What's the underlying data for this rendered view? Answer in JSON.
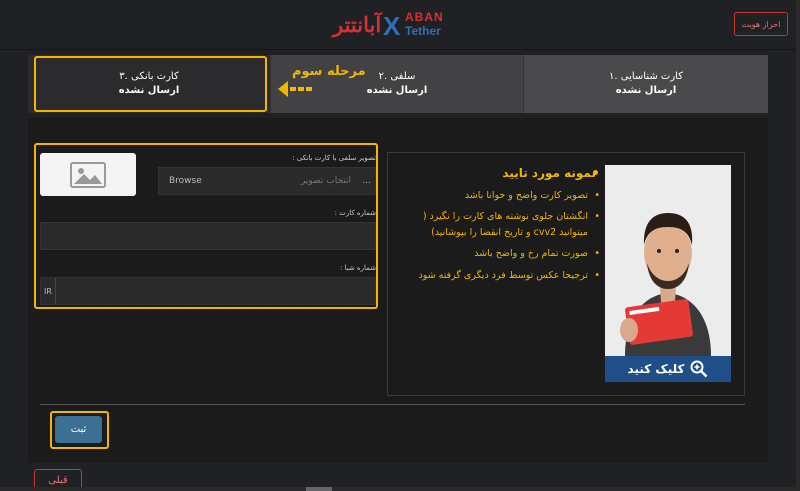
{
  "header": {
    "verify_label": "احراز هویت",
    "logo_fa": "آبانتتر",
    "logo_aban": "ABAN",
    "logo_tether": "Tether",
    "logo_x": "X"
  },
  "steps": [
    {
      "title": "۱. کارت شناسایی",
      "status": "ارسال نشده"
    },
    {
      "title": "۲. سلفی",
      "status": "ارسال نشده"
    },
    {
      "title": "۳. کارت بانکی",
      "status": "ارسال نشده"
    }
  ],
  "annotation": {
    "stage_label": "مرحله سوم"
  },
  "form": {
    "image_label": "تصویر سلفی با کارت بانکی :",
    "file_placeholder": "انتخاب تصویر",
    "browse_label": "Browse",
    "file_dots": "...",
    "card_label": "شماره کارت :",
    "card_value": "",
    "sheba_label": "شماره شبا :",
    "sheba_prefix": "IR",
    "sheba_value": ""
  },
  "sample": {
    "title": "نمونه مورد تایید",
    "bullets": [
      "تصویر کارت واضح و خوانا باشد",
      "انگشتان جلوی نوشته های کارت را نگیرد ( میتوانید cvv2 و تاریخ انقضا را بپوشانید)",
      "صورت تمام رخ و واضح باشد",
      "ترجیحا عکس توسط فرد دیگری گرفته شود"
    ],
    "click_label": "کلیک کنید"
  },
  "actions": {
    "submit_label": "ثبت",
    "prev_label": "قبلی"
  },
  "colors": {
    "highlight": "#f2b705",
    "brand_red": "#d63031",
    "brand_blue": "#2f6fb7",
    "button_blue": "#3c6f94"
  }
}
